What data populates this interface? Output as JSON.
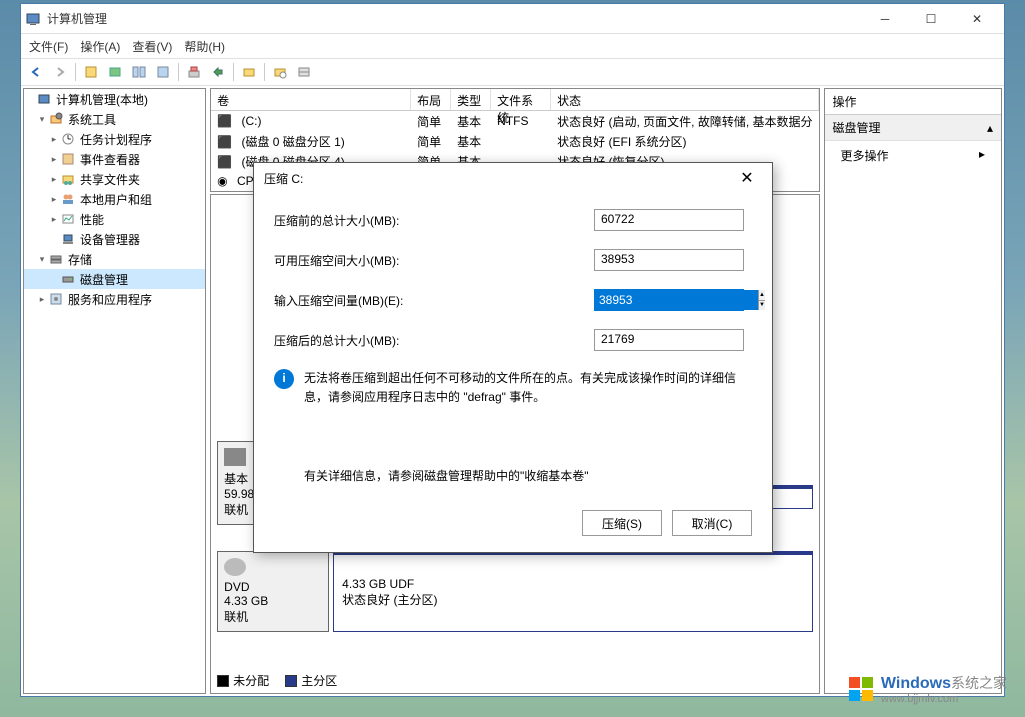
{
  "window": {
    "title": "计算机管理"
  },
  "menu": {
    "file": "文件(F)",
    "action": "操作(A)",
    "view": "查看(V)",
    "help": "帮助(H)"
  },
  "tree": {
    "root": "计算机管理(本地)",
    "system_tools": "系统工具",
    "task_scheduler": "任务计划程序",
    "event_viewer": "事件查看器",
    "shared_folders": "共享文件夹",
    "local_users": "本地用户和组",
    "performance": "性能",
    "device_manager": "设备管理器",
    "storage": "存储",
    "disk_management": "磁盘管理",
    "services_apps": "服务和应用程序"
  },
  "volumes": {
    "headers": {
      "volume": "卷",
      "layout": "布局",
      "type": "类型",
      "fs": "文件系统",
      "status": "状态"
    },
    "rows": [
      {
        "vol": "(C:)",
        "layout": "简单",
        "type": "基本",
        "fs": "NTFS",
        "status": "状态良好 (启动, 页面文件, 故障转储, 基本数据分"
      },
      {
        "vol": "(磁盘 0 磁盘分区 1)",
        "layout": "简单",
        "type": "基本",
        "fs": "",
        "status": "状态良好 (EFI 系统分区)"
      },
      {
        "vol": "(磁盘 0 磁盘分区 4)",
        "layout": "简单",
        "type": "基本",
        "fs": "",
        "status": "状态良好 (恢复分区)"
      },
      {
        "vol": "CP",
        "layout": "",
        "type": "",
        "fs": "",
        "status": ""
      }
    ]
  },
  "disks": {
    "basic": "基本",
    "size0": "59.98",
    "online": "联机",
    "dvd": "DVD",
    "size1": "4.33 GB",
    "udf": "4.33 GB UDF",
    "partstatus": "状态良好 (主分区)"
  },
  "legend": {
    "unallocated": "未分配",
    "primary": "主分区"
  },
  "actions": {
    "title": "操作",
    "section": "磁盘管理",
    "more": "更多操作"
  },
  "dialog": {
    "title": "压缩 C:",
    "before_label": "压缩前的总计大小(MB):",
    "before_value": "60722",
    "available_label": "可用压缩空间大小(MB):",
    "available_value": "38953",
    "input_label": "输入压缩空间量(MB)(E):",
    "input_value": "38953",
    "after_label": "压缩后的总计大小(MB):",
    "after_value": "21769",
    "info1": "无法将卷压缩到超出任何不可移动的文件所在的点。有关完成该操作时间的详细信息，请参阅应用程序日志中的 \"defrag\" 事件。",
    "info2": "有关详细信息，请参阅磁盘管理帮助中的\"收缩基本卷\"",
    "btn_shrink": "压缩(S)",
    "btn_cancel": "取消(C)"
  },
  "watermark": {
    "t1": "Windows",
    "t2": "系统之家",
    "url": "www.bjjmlv.com"
  }
}
